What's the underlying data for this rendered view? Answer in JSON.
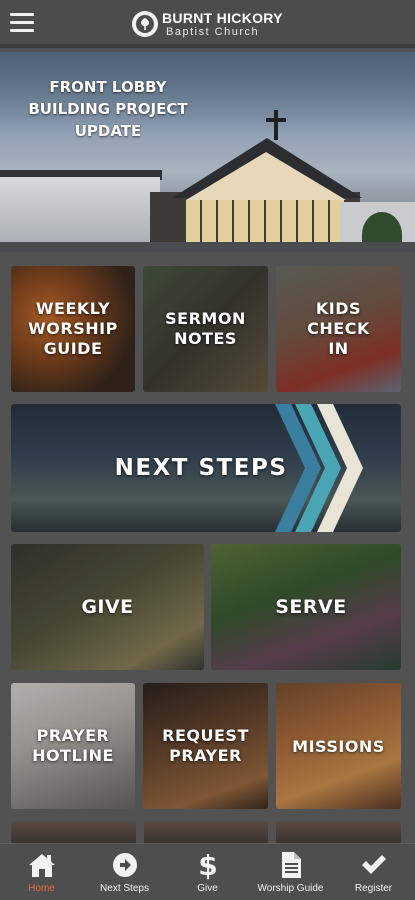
{
  "header": {
    "logo_line1": "BURNT HICKORY",
    "logo_line2": "Baptist Church"
  },
  "banner": {
    "title_line1": "FRONT LOBBY",
    "title_line2": "BUILDING PROJECT UPDATE"
  },
  "tiles": {
    "weekly": [
      "WEEKLY",
      "WORSHIP",
      "GUIDE"
    ],
    "sermon": [
      "SERMON",
      "NOTES"
    ],
    "kids": [
      "KIDS",
      "CHECK",
      "IN"
    ],
    "next_steps": "NEXT STEPS",
    "give": "GIVE",
    "serve": "SERVE",
    "prayer_hotline": [
      "PRAYER",
      "HOTLINE"
    ],
    "request_prayer": [
      "REQUEST",
      "PRAYER"
    ],
    "missions": "MISSIONS"
  },
  "nav": {
    "items": [
      {
        "label": "Home",
        "icon": "home-icon",
        "active": true
      },
      {
        "label": "Next Steps",
        "icon": "arrow-right-circle-icon",
        "active": false
      },
      {
        "label": "Give",
        "icon": "dollar-icon",
        "active": false
      },
      {
        "label": "Worship Guide",
        "icon": "document-icon",
        "active": false
      },
      {
        "label": "Register",
        "icon": "checkmark-icon",
        "active": false
      }
    ]
  },
  "colors": {
    "active_nav": "#e86b3a",
    "chevron_teal": "#4aa6b4",
    "chevron_blue": "#3a7fa0",
    "chevron_cream": "#e8e4d6"
  }
}
